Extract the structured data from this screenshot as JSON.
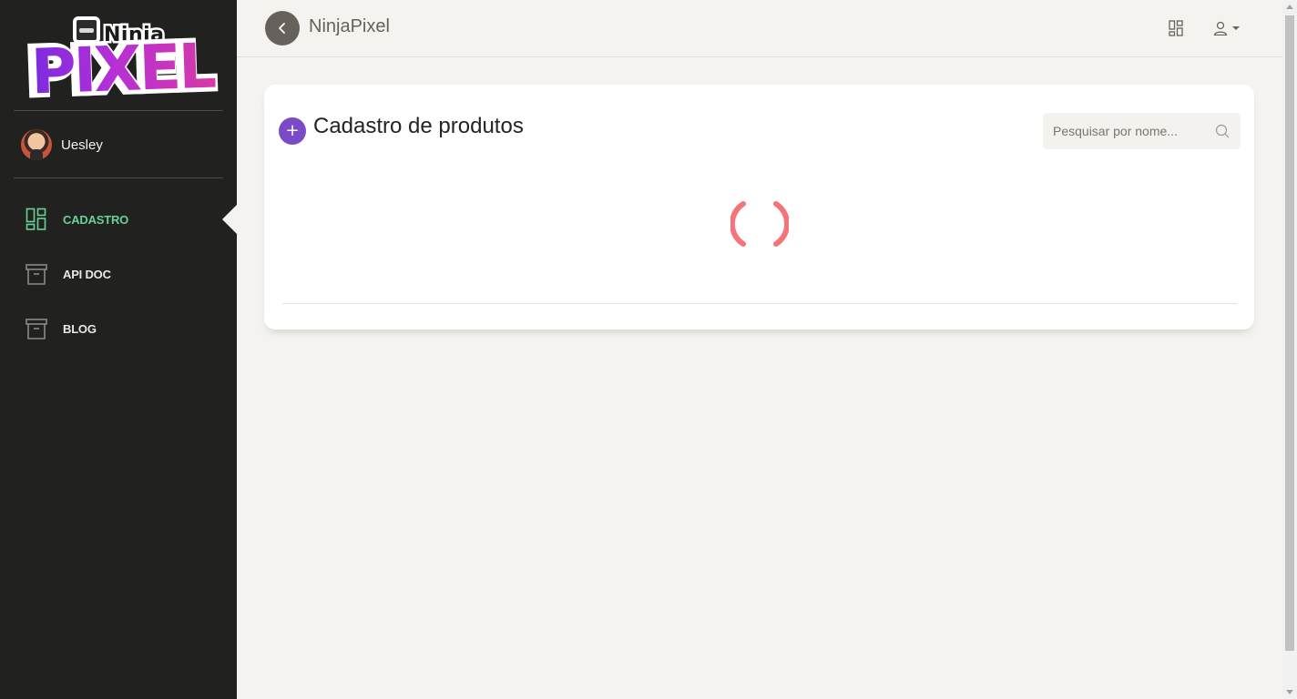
{
  "sidebar": {
    "logo": {
      "line1": "Ninja",
      "line2": "PIXEL"
    },
    "user": {
      "name": "Uesley"
    },
    "items": [
      {
        "label": "Cadastro",
        "icon": "dashboard-icon",
        "active": true
      },
      {
        "label": "API Doc",
        "icon": "archive-icon",
        "active": false
      },
      {
        "label": "Blog",
        "icon": "archive-icon",
        "active": false
      }
    ]
  },
  "header": {
    "brand": "NinjaPixel",
    "back_icon": "chevron-left-icon",
    "actions": [
      "dashboard-icon",
      "user-icon"
    ]
  },
  "main": {
    "title": "Cadastro de produtos",
    "add_icon": "plus-icon",
    "search": {
      "placeholder": "Pesquisar por nome...",
      "value": "",
      "icon": "search-icon"
    },
    "loading": true
  },
  "colors": {
    "sidebar_bg": "#212120",
    "page_bg": "#f4f3ef",
    "active": "#6bd098",
    "accent_purple": "#7b4bc7",
    "spinner": "#f5737a",
    "back_button": "#66615b"
  }
}
